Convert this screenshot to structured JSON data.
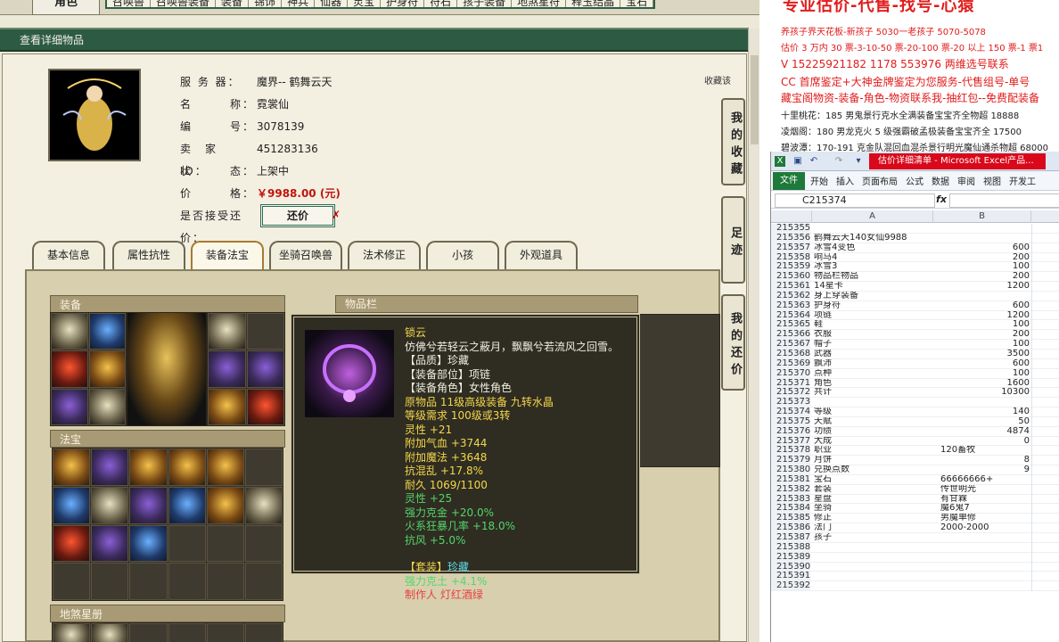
{
  "game": {
    "role_tab": "角色",
    "nav_items": [
      "召唤兽",
      "召唤兽装备",
      "装备",
      "锦饰",
      "神兵",
      "仙器",
      "灵宝",
      "护身符",
      "符石",
      "孩子装备",
      "地煞星符",
      "释玉结晶",
      "宝石"
    ],
    "detail_bar": "查看详细物品",
    "info": {
      "server_label": "服 务 器：",
      "server_value": "魔界-- 鹤舞云天",
      "name_label": "名　　　称：",
      "name_value": "霓裳仙",
      "id_label": "编　　　号：",
      "id_value": "3078139",
      "seller_label": "卖　家　ID：",
      "seller_value": "451283136",
      "status_label": "状　　　态：",
      "status_value": "上架中",
      "price_label": "价　　　格：",
      "price_value": "￥9988.00 (元)",
      "haggle_label": "是否接受还价：",
      "haggle_button": "还价",
      "haggle_x": "✗"
    },
    "fav_link": "收藏该",
    "side_buttons": [
      "我的收藏",
      "足迹",
      "我的还价"
    ],
    "tabs": [
      "基本信息",
      "属性抗性",
      "装备法宝",
      "坐骑召唤兽",
      "法术修正",
      "小孩",
      "外观道具"
    ],
    "active_tab": "装备法宝",
    "sections": {
      "equip": "装备",
      "fabao": "法宝",
      "xingce": "地煞星册",
      "itembar": "物品栏"
    },
    "tooltip": {
      "name": "锁云",
      "desc": "仿佛兮若轻云之蔽月，飘飘兮若流风之回雪。",
      "lines_white": [
        "【品质】珍藏",
        "【装备部位】项链",
        "【装备角色】女性角色"
      ],
      "lines_yellow": [
        "原物品 11级高级装备 九转水晶",
        "等级需求 100级或3转",
        "灵性 +21",
        "附加气血 +3744",
        "附加魔法 +3648",
        "抗混乱 +17.8%",
        "耐久 1069/1100"
      ],
      "lines_green": [
        "灵性 +25",
        "强力克金 +20.0%",
        "火系狂暴几率 +18.0%",
        "抗风 +5.0%"
      ],
      "set_label": "【套装】",
      "set_value": "珍藏",
      "set_line": "强力克土 +4.1%",
      "maker": "制作人 灯红酒绿"
    }
  },
  "ads": {
    "title": "专业估价-代售-找号-心猿",
    "lines": [
      "养孩子界天花板-新孩子 5030一老孩子 5070-5078",
      "估价 3 万内 30 票-3-10-50 票-20-100 票-20 以上 150 票-1 票1",
      "V 15225921182    1178 553976  两维选号联系",
      "CC 首席鉴定+大神金牌鉴定为您服务-代售组号-单号",
      "藏宝阁物资-装备-角色-物资联系我-抽红包--免费配装备",
      "十里桃花：185 男鬼景行克水全满装备宝宝齐全物超 18888",
      "凌烟阁：180 男龙克火 5 级强霸破孟极装备宝宝齐全 17500",
      "碧波潭：170-191 克金队混回血混杀景行明光魔仙通杀物超 68000"
    ]
  },
  "excel": {
    "window_title": "估价详细清单 - Microsoft Excel产品...",
    "ribbon_file": "文件",
    "ribbon_menus": [
      "开始",
      "插入",
      "页面布局",
      "公式",
      "数据",
      "审阅",
      "视图",
      "开发工"
    ],
    "name_box": "C215374",
    "fx": "fx",
    "col_a": "A",
    "col_b": "B",
    "rows": [
      {
        "n": "215355",
        "a": "",
        "b": ""
      },
      {
        "n": "215356",
        "a": "鹤舞云天140女仙9988",
        "b": ""
      },
      {
        "n": "215357",
        "a": "冰雪4变色",
        "b": "600"
      },
      {
        "n": "215358",
        "a": "响马4",
        "b": "200"
      },
      {
        "n": "215359",
        "a": "冰雪3",
        "b": "100"
      },
      {
        "n": "215360",
        "a": "物品栏物品",
        "b": "200"
      },
      {
        "n": "215361",
        "a": "14星卡",
        "b": "1200"
      },
      {
        "n": "215362",
        "a": "身上穿装备",
        "b": ""
      },
      {
        "n": "215363",
        "a": "护身符",
        "b": "600"
      },
      {
        "n": "215364",
        "a": "项链",
        "b": "1200"
      },
      {
        "n": "215365",
        "a": "鞋",
        "b": "100"
      },
      {
        "n": "215366",
        "a": "衣服",
        "b": "200"
      },
      {
        "n": "215367",
        "a": "帽子",
        "b": "100"
      },
      {
        "n": "215368",
        "a": "武器",
        "b": "3500"
      },
      {
        "n": "215369",
        "a": "飘沛",
        "b": "600"
      },
      {
        "n": "215370",
        "a": "点种",
        "b": "100"
      },
      {
        "n": "215371",
        "a": "角色",
        "b": "1600"
      },
      {
        "n": "215372",
        "a": "共计",
        "b": "10300"
      },
      {
        "n": "215373",
        "a": "",
        "b": ""
      },
      {
        "n": "215374",
        "a": "等级",
        "b": "140"
      },
      {
        "n": "215375",
        "a": "天赋",
        "b": "50"
      },
      {
        "n": "215376",
        "a": "功绩",
        "b": "4874"
      },
      {
        "n": "215377",
        "a": "大成",
        "b": "0"
      },
      {
        "n": "215378",
        "a": "职业",
        "b": "120畜牧",
        "bt": true
      },
      {
        "n": "215379",
        "a": "月饼",
        "b": "8"
      },
      {
        "n": "215380",
        "a": "兑换点数",
        "b": "9"
      },
      {
        "n": "215381",
        "a": "宝石",
        "b": "66666666+",
        "bt": true
      },
      {
        "n": "215382",
        "a": "套装",
        "b": "传世明光",
        "bt": true
      },
      {
        "n": "215383",
        "a": "星盘",
        "b": "有甘霖",
        "bt": true
      },
      {
        "n": "215384",
        "a": "坐骑",
        "b": "魔6鬼7",
        "bt": true
      },
      {
        "n": "215385",
        "a": "修正",
        "b": "男魔单修",
        "bt": true
      },
      {
        "n": "215386",
        "a": "法门",
        "b": "2000-2000",
        "bt": true
      },
      {
        "n": "215387",
        "a": "孩子",
        "b": ""
      },
      {
        "n": "215388",
        "a": "",
        "b": ""
      },
      {
        "n": "215389",
        "a": "",
        "b": ""
      },
      {
        "n": "215390",
        "a": "",
        "b": ""
      },
      {
        "n": "215391",
        "a": "",
        "b": ""
      },
      {
        "n": "215392",
        "a": "",
        "b": ""
      }
    ]
  }
}
